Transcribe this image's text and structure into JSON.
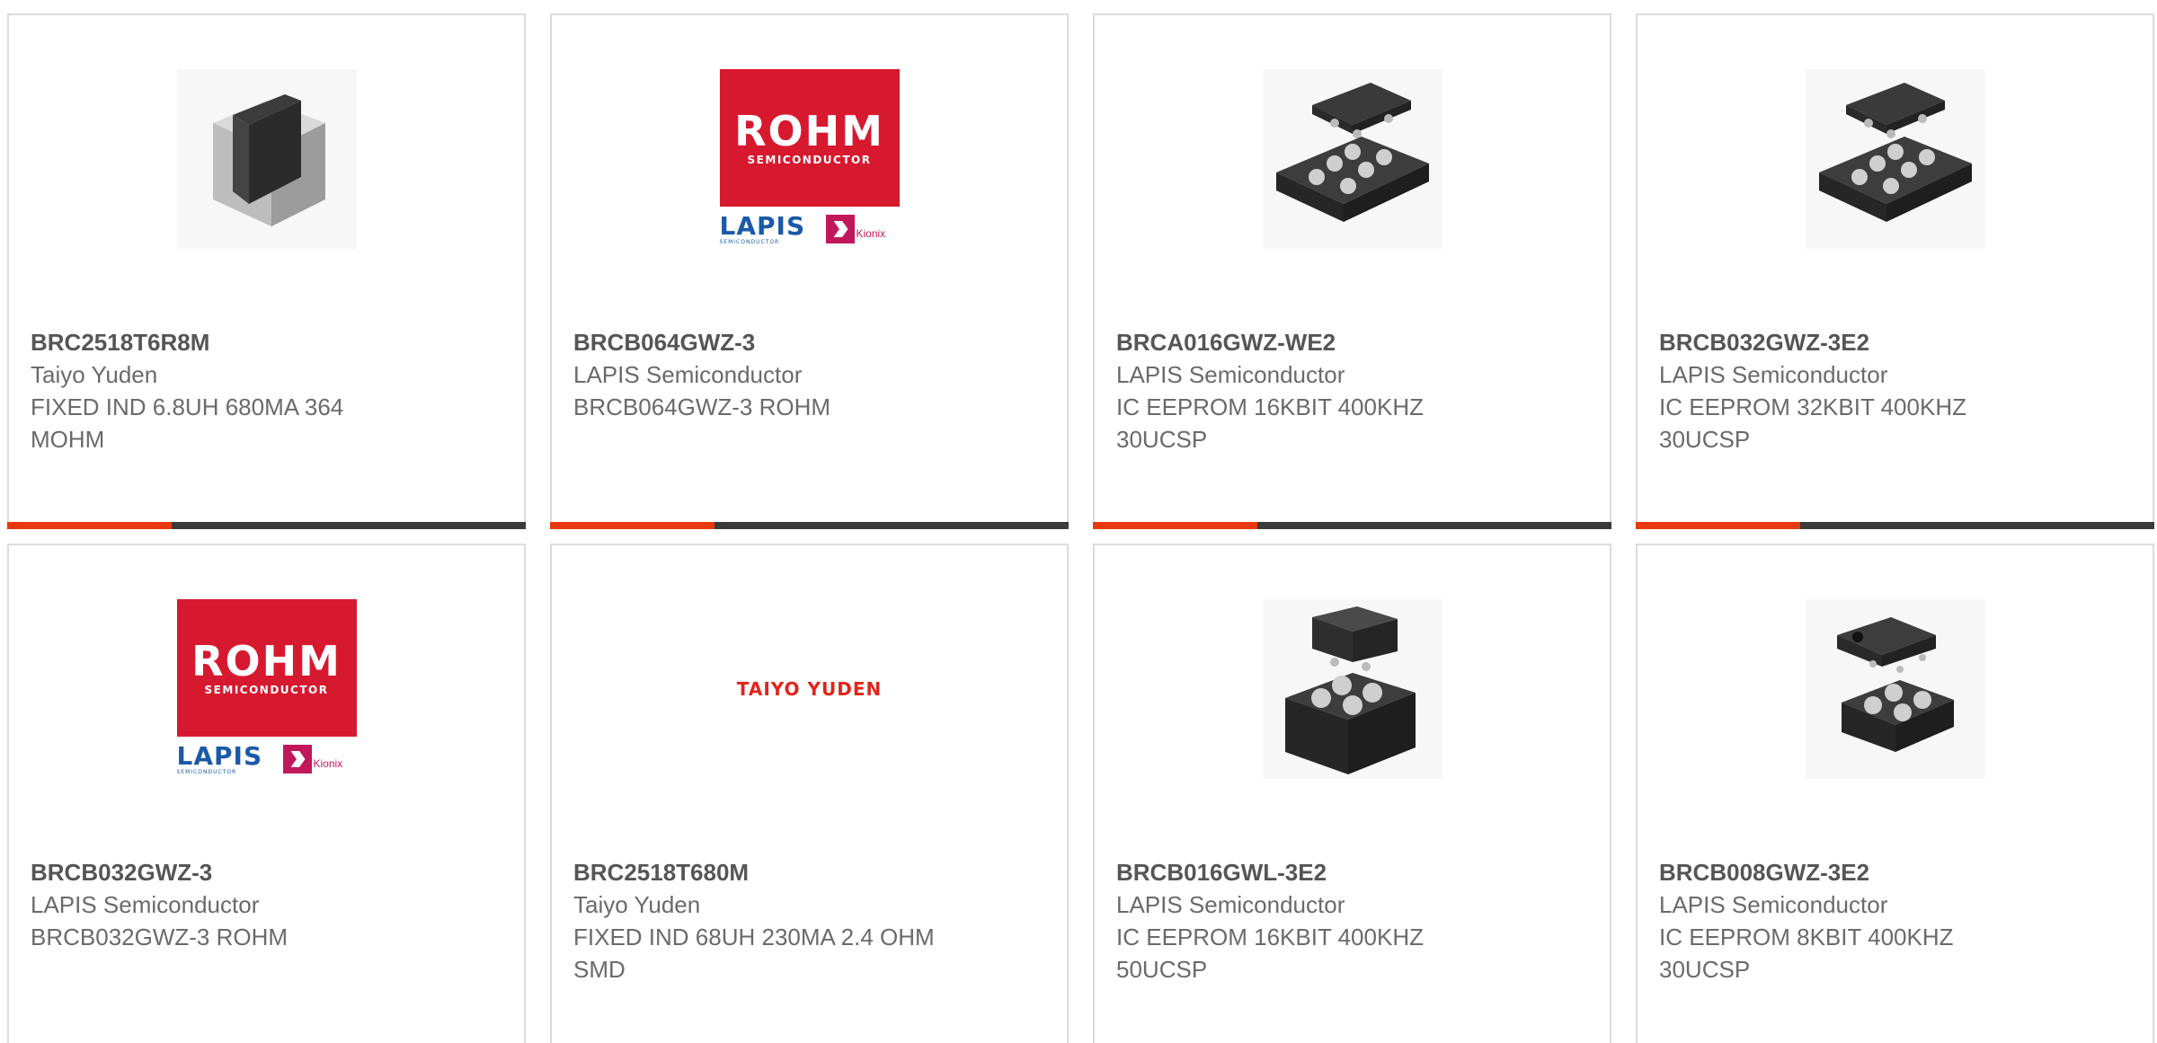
{
  "products": [
    {
      "part_number": "BRC2518T6R8M",
      "manufacturer": "Taiyo Yuden",
      "description": "FIXED IND 6.8UH 680MA 364 MOHM",
      "image": "chip-inductor"
    },
    {
      "part_number": "BRCB064GWZ-3",
      "manufacturer": "LAPIS Semiconductor",
      "description": "BRCB064GWZ-3 ROHM",
      "image": "rohm-lapis-logo"
    },
    {
      "part_number": "BRCA016GWZ-WE2",
      "manufacturer": "LAPIS Semiconductor",
      "description": "IC EEPROM 16KBIT 400KHZ 30UCSP",
      "image": "ucsp-package"
    },
    {
      "part_number": "BRCB032GWZ-3E2",
      "manufacturer": "LAPIS Semiconductor",
      "description": "IC EEPROM 32KBIT 400KHZ 30UCSP",
      "image": "ucsp-package"
    },
    {
      "part_number": "BRCB032GWZ-3",
      "manufacturer": "LAPIS Semiconductor",
      "description": "BRCB032GWZ-3 ROHM",
      "image": "rohm-lapis-logo"
    },
    {
      "part_number": "BRC2518T680M",
      "manufacturer": "Taiyo Yuden",
      "description": "FIXED IND 68UH 230MA 2.4 OHM SMD",
      "image": "taiyo-yuden-logo"
    },
    {
      "part_number": "BRCB016GWL-3E2",
      "manufacturer": "LAPIS Semiconductor",
      "description": "IC EEPROM 16KBIT 400KHZ 50UCSP",
      "image": "ucsp-package-square"
    },
    {
      "part_number": "BRCB008GWZ-3E2",
      "manufacturer": "LAPIS Semiconductor",
      "description": "IC EEPROM 8KBIT 400KHZ 30UCSP",
      "image": "ucsp-package-square-small"
    }
  ],
  "logos": {
    "rohm_big": "ROHM",
    "rohm_small": "SEMICONDUCTOR",
    "lapis": "LAPIS",
    "lapis_sub": "SEMICONDUCTOR",
    "kionix": "Kionix",
    "taiyo": "TAIYO YUDEN"
  },
  "colors": {
    "accent": "#e8380d",
    "bar": "#3a3a3a",
    "rohm_red": "#d7192f",
    "lapis_blue": "#1a5aa8",
    "kionix_magenta": "#c2185b",
    "taiyo_red": "#e0251b"
  }
}
